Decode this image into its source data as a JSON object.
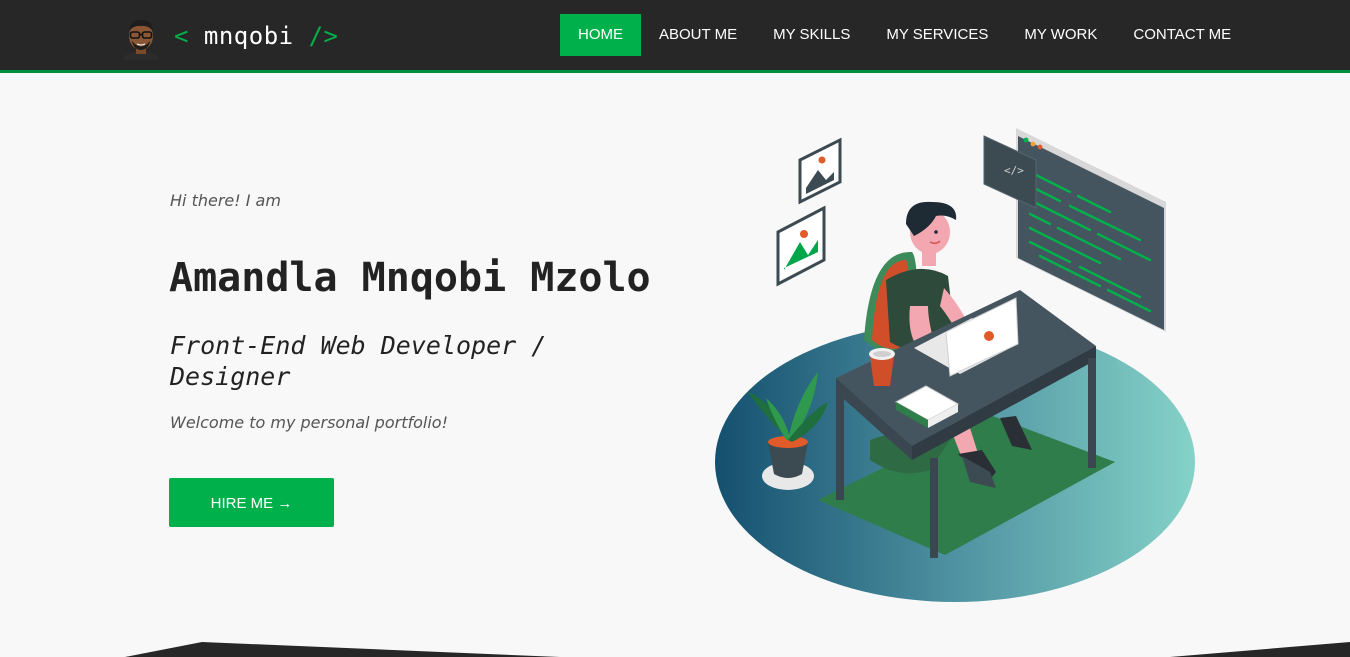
{
  "brand": {
    "open_tag": "<",
    "name": "mnqobi",
    "close_tag": "/>"
  },
  "nav": {
    "items": [
      {
        "label": "HOME",
        "active": true
      },
      {
        "label": "ABOUT ME",
        "active": false
      },
      {
        "label": "MY SKILLS",
        "active": false
      },
      {
        "label": "MY SERVICES",
        "active": false
      },
      {
        "label": "MY WORK",
        "active": false
      },
      {
        "label": "CONTACT ME",
        "active": false
      }
    ]
  },
  "hero": {
    "greeting": "Hi there! I am",
    "name": "Amandla Mnqobi Mzolo",
    "role": "Front-End Web Developer / Designer",
    "welcome": "Welcome to my personal portfolio!",
    "cta_label": "HIRE ME →",
    "screen_code_glyph": "</>"
  },
  "colors": {
    "navbar_bg": "#272727",
    "accent_green": "#00b14b",
    "page_bg": "#f8f8f8",
    "text_dark": "#222222"
  },
  "icons": [
    "avatar",
    "picture-frame-icon",
    "code-window-icon",
    "laptop-icon",
    "coffee-cup-icon",
    "potted-plant-icon"
  ]
}
